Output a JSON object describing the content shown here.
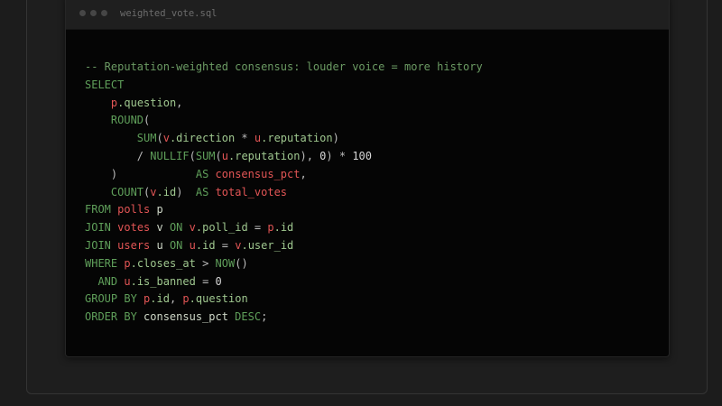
{
  "editor": {
    "filename": "weighted_vote.sql",
    "window_controls": [
      "close-dot",
      "minimize-dot",
      "maximize-dot"
    ]
  },
  "colors": {
    "comment": "#6b9a63",
    "keyword": "#5f9f5a",
    "table_alias": "#e25555",
    "identifier": "#9fc78f",
    "plain": "#cfd8c8"
  },
  "code": [
    [
      {
        "t": "comment",
        "v": "-- Reputation-weighted consensus: louder voice = more history"
      }
    ],
    [
      {
        "t": "keyword",
        "v": "SELECT"
      }
    ],
    [
      {
        "t": "plain",
        "v": "    "
      },
      {
        "t": "alias",
        "v": "p"
      },
      {
        "t": "ident",
        "v": ".question"
      },
      {
        "t": "punct",
        "v": ","
      }
    ],
    [
      {
        "t": "plain",
        "v": "    "
      },
      {
        "t": "keyword",
        "v": "ROUND"
      },
      {
        "t": "punct",
        "v": "("
      }
    ],
    [
      {
        "t": "plain",
        "v": "        "
      },
      {
        "t": "keyword",
        "v": "SUM"
      },
      {
        "t": "punct",
        "v": "("
      },
      {
        "t": "alias",
        "v": "v"
      },
      {
        "t": "ident",
        "v": ".direction"
      },
      {
        "t": "punct",
        "v": " * "
      },
      {
        "t": "alias",
        "v": "u"
      },
      {
        "t": "ident",
        "v": ".reputation"
      },
      {
        "t": "punct",
        "v": ")"
      }
    ],
    [
      {
        "t": "plain",
        "v": "        "
      },
      {
        "t": "punct",
        "v": "/ "
      },
      {
        "t": "keyword",
        "v": "NULLIF"
      },
      {
        "t": "punct",
        "v": "("
      },
      {
        "t": "keyword",
        "v": "SUM"
      },
      {
        "t": "punct",
        "v": "("
      },
      {
        "t": "alias",
        "v": "u"
      },
      {
        "t": "ident",
        "v": ".reputation"
      },
      {
        "t": "punct",
        "v": "), "
      },
      {
        "t": "number",
        "v": "0"
      },
      {
        "t": "punct",
        "v": ") * "
      },
      {
        "t": "number",
        "v": "100"
      }
    ],
    [
      {
        "t": "plain",
        "v": "    "
      },
      {
        "t": "punct",
        "v": ")"
      },
      {
        "t": "plain",
        "v": "            "
      },
      {
        "t": "keyword",
        "v": "AS"
      },
      {
        "t": "plain",
        "v": " "
      },
      {
        "t": "alias",
        "v": "consensus_pct"
      },
      {
        "t": "punct",
        "v": ","
      }
    ],
    [
      {
        "t": "plain",
        "v": "    "
      },
      {
        "t": "keyword",
        "v": "COUNT"
      },
      {
        "t": "punct",
        "v": "("
      },
      {
        "t": "alias",
        "v": "v"
      },
      {
        "t": "ident",
        "v": ".id"
      },
      {
        "t": "punct",
        "v": ")"
      },
      {
        "t": "plain",
        "v": "  "
      },
      {
        "t": "keyword",
        "v": "AS"
      },
      {
        "t": "plain",
        "v": " "
      },
      {
        "t": "alias",
        "v": "total_votes"
      }
    ],
    [
      {
        "t": "keyword",
        "v": "FROM"
      },
      {
        "t": "plain",
        "v": " "
      },
      {
        "t": "alias",
        "v": "polls"
      },
      {
        "t": "plain",
        "v": " p"
      }
    ],
    [
      {
        "t": "keyword",
        "v": "JOIN"
      },
      {
        "t": "plain",
        "v": " "
      },
      {
        "t": "alias",
        "v": "votes"
      },
      {
        "t": "plain",
        "v": " v "
      },
      {
        "t": "keyword",
        "v": "ON"
      },
      {
        "t": "plain",
        "v": " "
      },
      {
        "t": "alias",
        "v": "v"
      },
      {
        "t": "ident",
        "v": ".poll_id"
      },
      {
        "t": "punct",
        "v": " = "
      },
      {
        "t": "alias",
        "v": "p"
      },
      {
        "t": "ident",
        "v": ".id"
      }
    ],
    [
      {
        "t": "keyword",
        "v": "JOIN"
      },
      {
        "t": "plain",
        "v": " "
      },
      {
        "t": "alias",
        "v": "users"
      },
      {
        "t": "plain",
        "v": " u "
      },
      {
        "t": "keyword",
        "v": "ON"
      },
      {
        "t": "plain",
        "v": " "
      },
      {
        "t": "alias",
        "v": "u"
      },
      {
        "t": "ident",
        "v": ".id"
      },
      {
        "t": "punct",
        "v": " = "
      },
      {
        "t": "alias",
        "v": "v"
      },
      {
        "t": "ident",
        "v": ".user_id"
      }
    ],
    [
      {
        "t": "keyword",
        "v": "WHERE"
      },
      {
        "t": "plain",
        "v": " "
      },
      {
        "t": "alias",
        "v": "p"
      },
      {
        "t": "ident",
        "v": ".closes_at"
      },
      {
        "t": "punct",
        "v": " > "
      },
      {
        "t": "keyword",
        "v": "NOW"
      },
      {
        "t": "punct",
        "v": "()"
      }
    ],
    [
      {
        "t": "plain",
        "v": "  "
      },
      {
        "t": "keyword",
        "v": "AND"
      },
      {
        "t": "plain",
        "v": " "
      },
      {
        "t": "alias",
        "v": "u"
      },
      {
        "t": "ident",
        "v": ".is_banned"
      },
      {
        "t": "punct",
        "v": " = "
      },
      {
        "t": "number",
        "v": "0"
      }
    ],
    [
      {
        "t": "keyword",
        "v": "GROUP BY"
      },
      {
        "t": "plain",
        "v": " "
      },
      {
        "t": "alias",
        "v": "p"
      },
      {
        "t": "ident",
        "v": ".id"
      },
      {
        "t": "punct",
        "v": ", "
      },
      {
        "t": "alias",
        "v": "p"
      },
      {
        "t": "ident",
        "v": ".question"
      }
    ],
    [
      {
        "t": "keyword",
        "v": "ORDER BY"
      },
      {
        "t": "plain",
        "v": " consensus_pct "
      },
      {
        "t": "keyword",
        "v": "DESC"
      },
      {
        "t": "punct",
        "v": ";"
      }
    ]
  ]
}
